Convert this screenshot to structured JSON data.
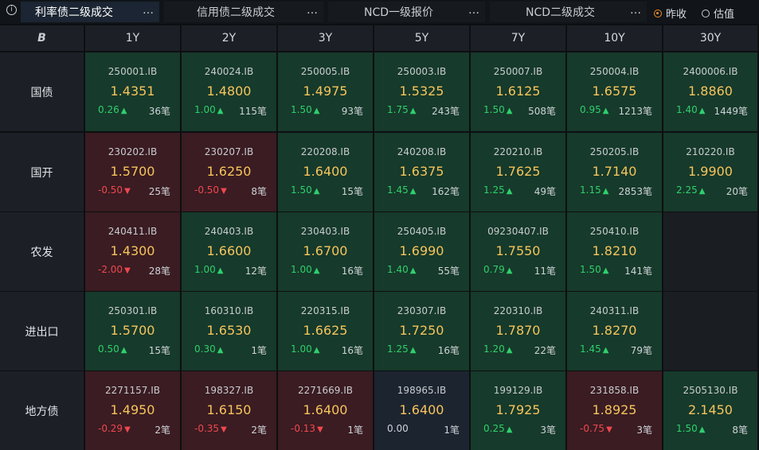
{
  "tabs": [
    {
      "label": "利率债二级成交",
      "active": true
    },
    {
      "label": "信用债二级成交",
      "active": false
    },
    {
      "label": "NCD一级报价",
      "active": false
    },
    {
      "label": "NCD二级成交",
      "active": false
    }
  ],
  "tab_menu_icon": "…",
  "radio": {
    "yesterday": "昨收",
    "valuation": "估值",
    "selected": "yesterday"
  },
  "corner_logo": "B",
  "tenors": [
    "1Y",
    "2Y",
    "3Y",
    "5Y",
    "7Y",
    "10Y",
    "30Y"
  ],
  "rows": [
    {
      "name": "国债",
      "cells": [
        {
          "code": "250001.IB",
          "price": "1.4351",
          "change": "0.26",
          "dir": "up",
          "count": "36笔"
        },
        {
          "code": "240024.IB",
          "price": "1.4800",
          "change": "1.00",
          "dir": "up",
          "count": "115笔"
        },
        {
          "code": "250005.IB",
          "price": "1.4975",
          "change": "1.50",
          "dir": "up",
          "count": "93笔"
        },
        {
          "code": "250003.IB",
          "price": "1.5325",
          "change": "1.75",
          "dir": "up",
          "count": "243笔"
        },
        {
          "code": "250007.IB",
          "price": "1.6125",
          "change": "1.50",
          "dir": "up",
          "count": "508笔"
        },
        {
          "code": "250004.IB",
          "price": "1.6575",
          "change": "0.95",
          "dir": "up",
          "count": "1213笔"
        },
        {
          "code": "2400006.IB",
          "price": "1.8860",
          "change": "1.40",
          "dir": "up",
          "count": "1449笔"
        }
      ]
    },
    {
      "name": "国开",
      "cells": [
        {
          "code": "230202.IB",
          "price": "1.5700",
          "change": "-0.50",
          "dir": "down",
          "count": "25笔"
        },
        {
          "code": "230207.IB",
          "price": "1.6250",
          "change": "-0.50",
          "dir": "down",
          "count": "8笔"
        },
        {
          "code": "220208.IB",
          "price": "1.6400",
          "change": "1.50",
          "dir": "up",
          "count": "15笔"
        },
        {
          "code": "240208.IB",
          "price": "1.6375",
          "change": "1.45",
          "dir": "up",
          "count": "162笔"
        },
        {
          "code": "220210.IB",
          "price": "1.7625",
          "change": "1.25",
          "dir": "up",
          "count": "49笔"
        },
        {
          "code": "250205.IB",
          "price": "1.7140",
          "change": "1.15",
          "dir": "up",
          "count": "2853笔"
        },
        {
          "code": "210220.IB",
          "price": "1.9900",
          "change": "2.25",
          "dir": "up",
          "count": "20笔"
        }
      ]
    },
    {
      "name": "农发",
      "cells": [
        {
          "code": "240411.IB",
          "price": "1.4300",
          "change": "-2.00",
          "dir": "down",
          "count": "28笔"
        },
        {
          "code": "240403.IB",
          "price": "1.6600",
          "change": "1.00",
          "dir": "up",
          "count": "12笔"
        },
        {
          "code": "230403.IB",
          "price": "1.6700",
          "change": "1.00",
          "dir": "up",
          "count": "16笔"
        },
        {
          "code": "250405.IB",
          "price": "1.6990",
          "change": "1.40",
          "dir": "up",
          "count": "55笔"
        },
        {
          "code": "09230407.IB",
          "price": "1.7550",
          "change": "0.79",
          "dir": "up",
          "count": "11笔"
        },
        {
          "code": "250410.IB",
          "price": "1.8210",
          "change": "1.50",
          "dir": "up",
          "count": "141笔"
        },
        null
      ]
    },
    {
      "name": "进出口",
      "cells": [
        {
          "code": "250301.IB",
          "price": "1.5700",
          "change": "0.50",
          "dir": "up",
          "count": "15笔"
        },
        {
          "code": "160310.IB",
          "price": "1.6530",
          "change": "0.30",
          "dir": "up",
          "count": "1笔"
        },
        {
          "code": "220315.IB",
          "price": "1.6625",
          "change": "1.00",
          "dir": "up",
          "count": "16笔"
        },
        {
          "code": "230307.IB",
          "price": "1.7250",
          "change": "1.25",
          "dir": "up",
          "count": "16笔"
        },
        {
          "code": "220310.IB",
          "price": "1.7870",
          "change": "1.20",
          "dir": "up",
          "count": "22笔"
        },
        {
          "code": "240311.IB",
          "price": "1.8270",
          "change": "1.45",
          "dir": "up",
          "count": "79笔"
        },
        null
      ]
    },
    {
      "name": "地方债",
      "cells": [
        {
          "code": "2271157.IB",
          "price": "1.4950",
          "change": "-0.29",
          "dir": "down",
          "count": "2笔"
        },
        {
          "code": "198327.IB",
          "price": "1.6150",
          "change": "-0.35",
          "dir": "down",
          "count": "2笔"
        },
        {
          "code": "2271669.IB",
          "price": "1.6400",
          "change": "-0.13",
          "dir": "down",
          "count": "1笔"
        },
        {
          "code": "198965.IB",
          "price": "1.6400",
          "change": "0.00",
          "dir": "flat",
          "count": "1笔"
        },
        {
          "code": "199129.IB",
          "price": "1.7925",
          "change": "0.25",
          "dir": "up",
          "count": "3笔"
        },
        {
          "code": "231858.IB",
          "price": "1.8925",
          "change": "-0.75",
          "dir": "down",
          "count": "3笔"
        },
        {
          "code": "2505130.IB",
          "price": "2.1450",
          "change": "1.50",
          "dir": "up",
          "count": "8笔"
        }
      ]
    }
  ],
  "colors": {
    "up_bg": "#163a2b",
    "down_bg": "#3a1c22",
    "flat_bg": "#1c2430",
    "empty_bg": "#1a1d22",
    "up_text": "#2fd06c",
    "down_text": "#f0474f",
    "price": "#f6c45c"
  }
}
